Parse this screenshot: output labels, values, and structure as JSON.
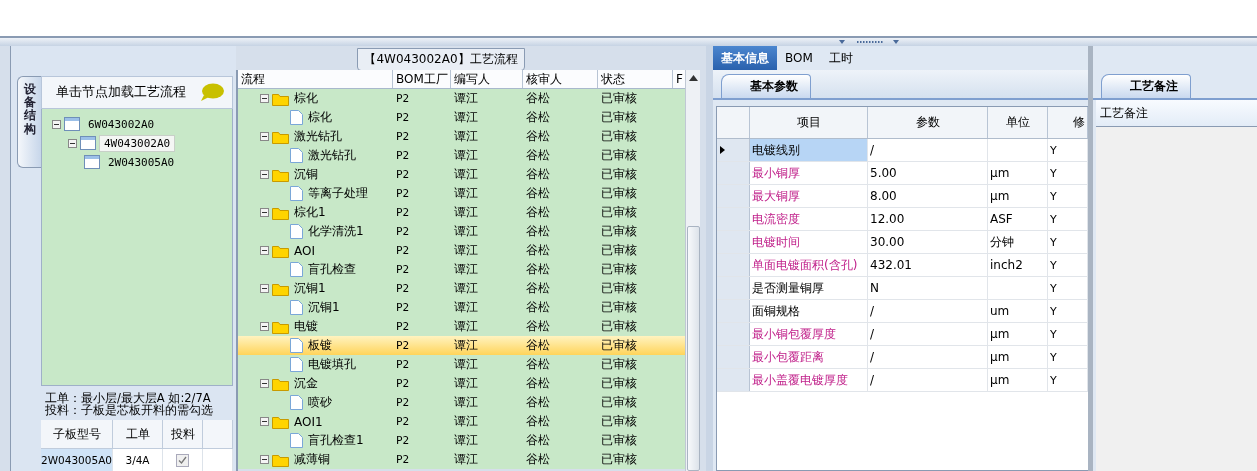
{
  "left_panel": {
    "side_tab": "设备结构",
    "hint": "单击节点加载工艺流程",
    "tree": [
      {
        "label": "6W043002A0",
        "expanded": true,
        "selected": false,
        "children": [
          {
            "label": "4W043002A0",
            "expanded": true,
            "selected": true,
            "children": [
              {
                "label": "2W043005A0",
                "selected": false
              }
            ]
          }
        ]
      }
    ],
    "notes": [
      "工单：最小层/最大层A 如:2/7A",
      "投料：子板是芯板开料的需勾选"
    ],
    "sub_table": {
      "columns": [
        "子板型号",
        "工单",
        "投料"
      ],
      "rows": [
        {
          "model": "2W043005A0",
          "order": "3/4A",
          "feed": true
        }
      ]
    }
  },
  "process_grid": {
    "title": "【4W043002A0】工艺流程",
    "columns": [
      "流程",
      "BOM工厂",
      "编写人",
      "核审人",
      "状态",
      "F"
    ],
    "rows": [
      {
        "name": "棕化",
        "bom": "P2",
        "writer": "谭江",
        "reviewer": "谷松",
        "status": "已审核",
        "expanded": true,
        "selected": false,
        "children": [
          {
            "name": "棕化",
            "bom": "P2",
            "writer": "谭江",
            "reviewer": "谷松",
            "status": "已审核",
            "selected": false
          }
        ]
      },
      {
        "name": "激光钻孔",
        "bom": "P2",
        "writer": "谭江",
        "reviewer": "谷松",
        "status": "已审核",
        "expanded": true,
        "selected": false,
        "children": [
          {
            "name": "激光钻孔",
            "bom": "P2",
            "writer": "谭江",
            "reviewer": "谷松",
            "status": "已审核",
            "selected": false
          }
        ]
      },
      {
        "name": "沉铜",
        "bom": "P2",
        "writer": "谭江",
        "reviewer": "谷松",
        "status": "已审核",
        "expanded": true,
        "selected": false,
        "children": [
          {
            "name": "等离子处理",
            "bom": "P2",
            "writer": "谭江",
            "reviewer": "谷松",
            "status": "已审核",
            "selected": false
          }
        ]
      },
      {
        "name": "棕化1",
        "bom": "P2",
        "writer": "谭江",
        "reviewer": "谷松",
        "status": "已审核",
        "expanded": true,
        "selected": false,
        "children": [
          {
            "name": "化学清洗1",
            "bom": "P2",
            "writer": "谭江",
            "reviewer": "谷松",
            "status": "已审核",
            "selected": false
          }
        ]
      },
      {
        "name": "AOI",
        "bom": "P2",
        "writer": "谭江",
        "reviewer": "谷松",
        "status": "已审核",
        "expanded": true,
        "selected": false,
        "children": [
          {
            "name": "盲孔检查",
            "bom": "P2",
            "writer": "谭江",
            "reviewer": "谷松",
            "status": "已审核",
            "selected": false
          }
        ]
      },
      {
        "name": "沉铜1",
        "bom": "P2",
        "writer": "谭江",
        "reviewer": "谷松",
        "status": "已审核",
        "expanded": true,
        "selected": false,
        "children": [
          {
            "name": "沉铜1",
            "bom": "P2",
            "writer": "谭江",
            "reviewer": "谷松",
            "status": "已审核",
            "selected": false
          }
        ]
      },
      {
        "name": "电镀",
        "bom": "P2",
        "writer": "谭江",
        "reviewer": "谷松",
        "status": "已审核",
        "expanded": true,
        "selected": false,
        "children": [
          {
            "name": "板镀",
            "bom": "P2",
            "writer": "谭江",
            "reviewer": "谷松",
            "status": "已审核",
            "selected": true
          },
          {
            "name": "电镀填孔",
            "bom": "P2",
            "writer": "谭江",
            "reviewer": "谷松",
            "status": "已审核",
            "selected": false
          }
        ]
      },
      {
        "name": "沉金",
        "bom": "P2",
        "writer": "谭江",
        "reviewer": "谷松",
        "status": "已审核",
        "expanded": true,
        "selected": false,
        "children": [
          {
            "name": "喷砂",
            "bom": "P2",
            "writer": "谭江",
            "reviewer": "谷松",
            "status": "已审核",
            "selected": false
          }
        ]
      },
      {
        "name": "AOI1",
        "bom": "P2",
        "writer": "谭江",
        "reviewer": "谷松",
        "status": "已审核",
        "expanded": true,
        "selected": false,
        "children": [
          {
            "name": "盲孔检查1",
            "bom": "P2",
            "writer": "谭江",
            "reviewer": "谷松",
            "status": "已审核",
            "selected": false
          }
        ]
      },
      {
        "name": "减薄铜",
        "bom": "P2",
        "writer": "谭江",
        "reviewer": "谷松",
        "status": "已审核",
        "expanded": true,
        "selected": false
      }
    ]
  },
  "info_panel": {
    "tabs": [
      {
        "label": "基本信息",
        "selected": true
      },
      {
        "label": "BOM",
        "selected": false
      },
      {
        "label": "工时",
        "selected": false
      }
    ],
    "sub_tab": "基本参数",
    "columns": [
      "项目",
      "参数",
      "单位",
      "修"
    ],
    "rows": [
      {
        "item": "电镀线别",
        "value": "/",
        "unit": "",
        "modify": "Y",
        "required": false,
        "selected": true
      },
      {
        "item": "最小铜厚",
        "value": "5.00",
        "unit": "μm",
        "modify": "Y",
        "required": true,
        "selected": false
      },
      {
        "item": "最大铜厚",
        "value": "8.00",
        "unit": "μm",
        "modify": "Y",
        "required": true,
        "selected": false
      },
      {
        "item": "电流密度",
        "value": "12.00",
        "unit": "ASF",
        "modify": "Y",
        "required": true,
        "selected": false
      },
      {
        "item": "电镀时间",
        "value": "30.00",
        "unit": "分钟",
        "modify": "Y",
        "required": true,
        "selected": false
      },
      {
        "item": "单面电镀面积(含孔)",
        "value": "432.01",
        "unit": "inch2",
        "modify": "Y",
        "required": true,
        "selected": false
      },
      {
        "item": "是否测量铜厚",
        "value": "N",
        "unit": "",
        "modify": "Y",
        "required": false,
        "selected": false
      },
      {
        "item": "面铜规格",
        "value": "/",
        "unit": "um",
        "modify": "Y",
        "required": false,
        "selected": false
      },
      {
        "item": "最小铜包覆厚度",
        "value": "/",
        "unit": "μm",
        "modify": "Y",
        "required": true,
        "selected": false
      },
      {
        "item": "最小包覆距离",
        "value": "/",
        "unit": "μm",
        "modify": "Y",
        "required": true,
        "selected": false
      },
      {
        "item": "最小盖覆电镀厚度",
        "value": "/",
        "unit": "μm",
        "modify": "Y",
        "required": true,
        "selected": false
      }
    ]
  },
  "notes_panel": {
    "tab": "工艺备注",
    "header": "工艺备注"
  }
}
